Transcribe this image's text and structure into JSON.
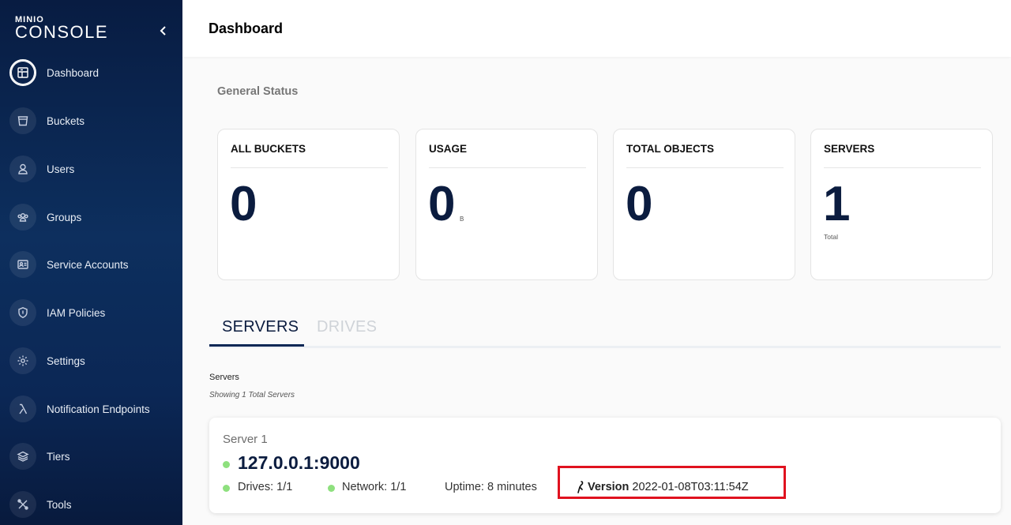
{
  "brand": {
    "top": "MINIO",
    "bottom": "CONSOLE"
  },
  "sidebar": {
    "items": [
      {
        "label": "Dashboard",
        "icon": "dashboard-icon",
        "active": true
      },
      {
        "label": "Buckets",
        "icon": "bucket-icon"
      },
      {
        "label": "Users",
        "icon": "user-icon"
      },
      {
        "label": "Groups",
        "icon": "groups-icon"
      },
      {
        "label": "Service Accounts",
        "icon": "service-account-icon"
      },
      {
        "label": "IAM Policies",
        "icon": "shield-icon"
      },
      {
        "label": "Settings",
        "icon": "gear-icon"
      },
      {
        "label": "Notification Endpoints",
        "icon": "lambda-icon"
      },
      {
        "label": "Tiers",
        "icon": "layers-icon"
      },
      {
        "label": "Tools",
        "icon": "tools-icon"
      }
    ]
  },
  "header": {
    "title": "Dashboard"
  },
  "general_status": {
    "title": "General Status",
    "cards": [
      {
        "title": "ALL BUCKETS",
        "value": "0",
        "unit": "",
        "sub": ""
      },
      {
        "title": "USAGE",
        "value": "0",
        "unit": "B",
        "sub": ""
      },
      {
        "title": "TOTAL OBJECTS",
        "value": "0",
        "unit": "",
        "sub": ""
      },
      {
        "title": "SERVERS",
        "value": "1",
        "unit": "",
        "sub": "Total"
      }
    ]
  },
  "tabs": [
    {
      "label": "SERVERS",
      "active": true
    },
    {
      "label": "DRIVES",
      "active": false
    }
  ],
  "servers": {
    "label": "Servers",
    "count_text": "Showing 1 Total Servers",
    "list": [
      {
        "name": "Server 1",
        "address": "127.0.0.1:9000",
        "drives": "Drives: 1/1",
        "network": "Network: 1/1",
        "uptime": "Uptime: 8 minutes",
        "version_label": "Version",
        "version": "2022-01-08T03:11:54Z"
      }
    ]
  },
  "colors": {
    "online": "#8ee07e",
    "highlight": "#e0121f",
    "navy": "#0b1c3f"
  }
}
